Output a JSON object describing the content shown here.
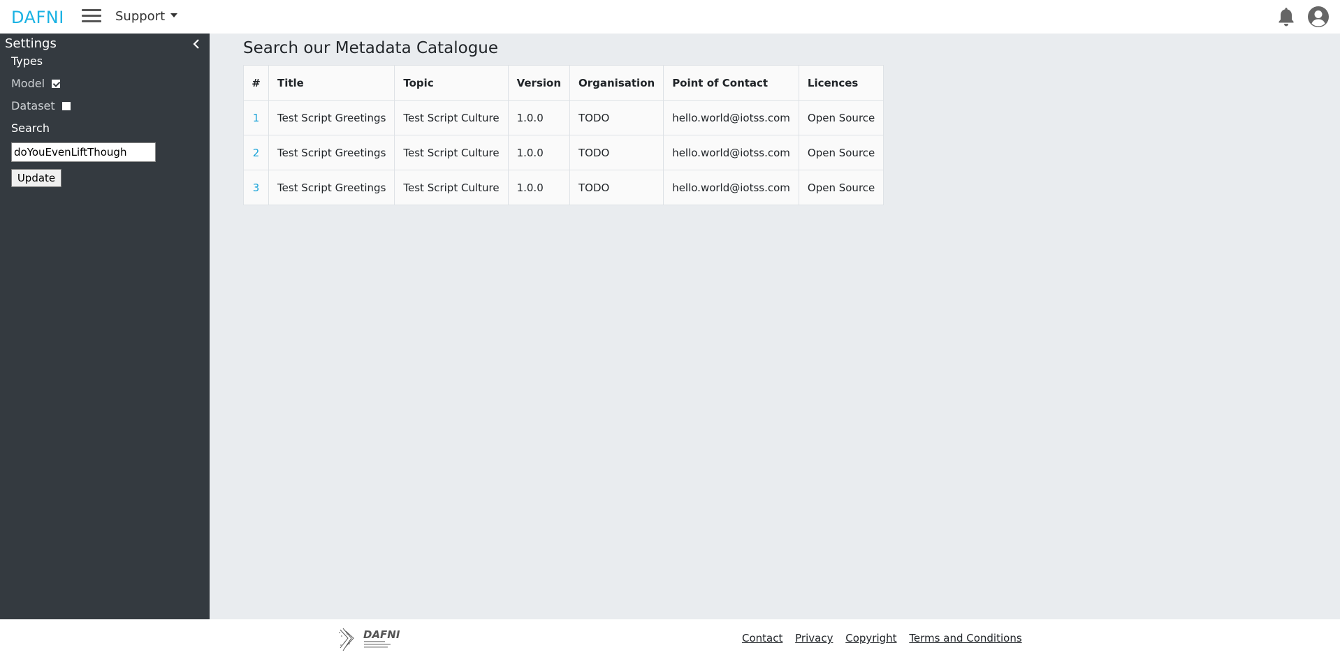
{
  "header": {
    "brand": "DAFNI",
    "support_label": "Support"
  },
  "sidebar": {
    "title": "Settings",
    "types_label": "Types",
    "model_label": "Model",
    "model_checked": true,
    "dataset_label": "Dataset",
    "dataset_checked": false,
    "search_label": "Search",
    "search_value": "doYouEvenLiftThough",
    "update_label": "Update"
  },
  "main": {
    "title": "Search our Metadata Catalogue",
    "columns": [
      "#",
      "Title",
      "Topic",
      "Version",
      "Organisation",
      "Point of Contact",
      "Licences"
    ],
    "rows": [
      {
        "num": "1",
        "title": "Test Script Greetings",
        "topic": "Test Script Culture",
        "version": "1.0.0",
        "org": "TODO",
        "contact": "hello.world@iotss.com",
        "licence": "Open Source"
      },
      {
        "num": "2",
        "title": "Test Script Greetings",
        "topic": "Test Script Culture",
        "version": "1.0.0",
        "org": "TODO",
        "contact": "hello.world@iotss.com",
        "licence": "Open Source"
      },
      {
        "num": "3",
        "title": "Test Script Greetings",
        "topic": "Test Script Culture",
        "version": "1.0.0",
        "org": "TODO",
        "contact": "hello.world@iotss.com",
        "licence": "Open Source"
      }
    ]
  },
  "footer": {
    "logo_text": "DAFNI",
    "links": [
      "Contact",
      "Privacy",
      "Copyright",
      "Terms and Conditions"
    ]
  },
  "colors": {
    "brand": "#1ab2e3",
    "sidebar_bg": "#343a40",
    "page_bg": "#e9ecef",
    "link": "#17a2d8"
  }
}
